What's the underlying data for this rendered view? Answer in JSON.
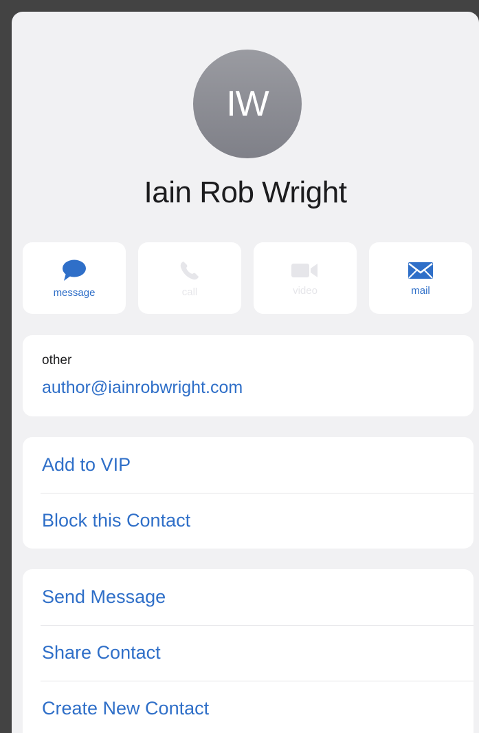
{
  "contact": {
    "initials": "IW",
    "name": "Iain Rob Wright"
  },
  "actions": [
    {
      "label": "message",
      "icon": "message-icon",
      "enabled": true
    },
    {
      "label": "call",
      "icon": "phone-icon",
      "enabled": false
    },
    {
      "label": "video",
      "icon": "video-icon",
      "enabled": false
    },
    {
      "label": "mail",
      "icon": "mail-icon",
      "enabled": true
    }
  ],
  "email": {
    "label": "other",
    "value": "author@iainrobwright.com"
  },
  "vip_section": {
    "add_vip": "Add to VIP",
    "block": "Block this Contact"
  },
  "share_section": {
    "send_message": "Send Message",
    "share_contact": "Share Contact",
    "create_contact": "Create New Contact"
  },
  "colors": {
    "accent": "#2f6fc8",
    "background": "#f1f1f3",
    "frame": "#434343",
    "avatar": "#8a8b92"
  }
}
